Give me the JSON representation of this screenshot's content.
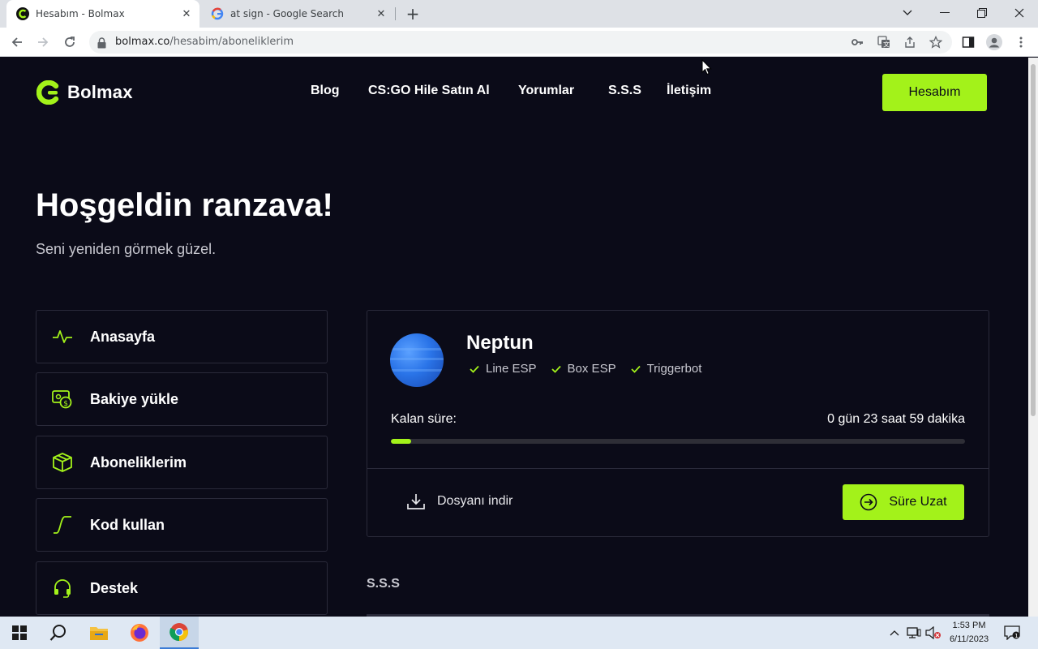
{
  "browser": {
    "tabs": [
      {
        "title": "Hesabım - Bolmax",
        "favicon": "bolmax-favicon"
      },
      {
        "title": "at sign - Google Search",
        "favicon": "google-favicon"
      }
    ],
    "url_host": "bolmax.co",
    "url_path": "/hesabim/aboneliklerim"
  },
  "site": {
    "brand": "Bolmax",
    "accent_color": "#a3f21a",
    "background_color": "#0b0b18",
    "nav": [
      "Blog",
      "CS:GO Hile Satın Al",
      "Yorumlar",
      "S.S.S",
      "İletişim"
    ],
    "account_button": "Hesabım"
  },
  "welcome": {
    "title": "Hoşgeldin ranzava!",
    "subtitle": "Seni yeniden görmek güzel."
  },
  "sidebar": {
    "items": [
      {
        "label": "Anasayfa",
        "icon": "activity-icon"
      },
      {
        "label": "Bakiye yükle",
        "icon": "wallet-icon"
      },
      {
        "label": "Aboneliklerim",
        "icon": "box-icon"
      },
      {
        "label": "Kod kullan",
        "icon": "curve-icon"
      },
      {
        "label": "Destek",
        "icon": "headset-icon"
      }
    ]
  },
  "subscription": {
    "name": "Neptun",
    "features": [
      "Line ESP",
      "Box ESP",
      "Triggerbot"
    ],
    "remaining_label": "Kalan süre:",
    "remaining_value": "0 gün 23 saat 59 dakika",
    "progress_percent": 3.5,
    "download_label": "Dosyanı indir",
    "extend_label": "Süre Uzat"
  },
  "faq": {
    "heading": "S.S.S"
  },
  "taskbar": {
    "time": "1:53 PM",
    "date": "6/11/2023",
    "notification_count": "1"
  }
}
